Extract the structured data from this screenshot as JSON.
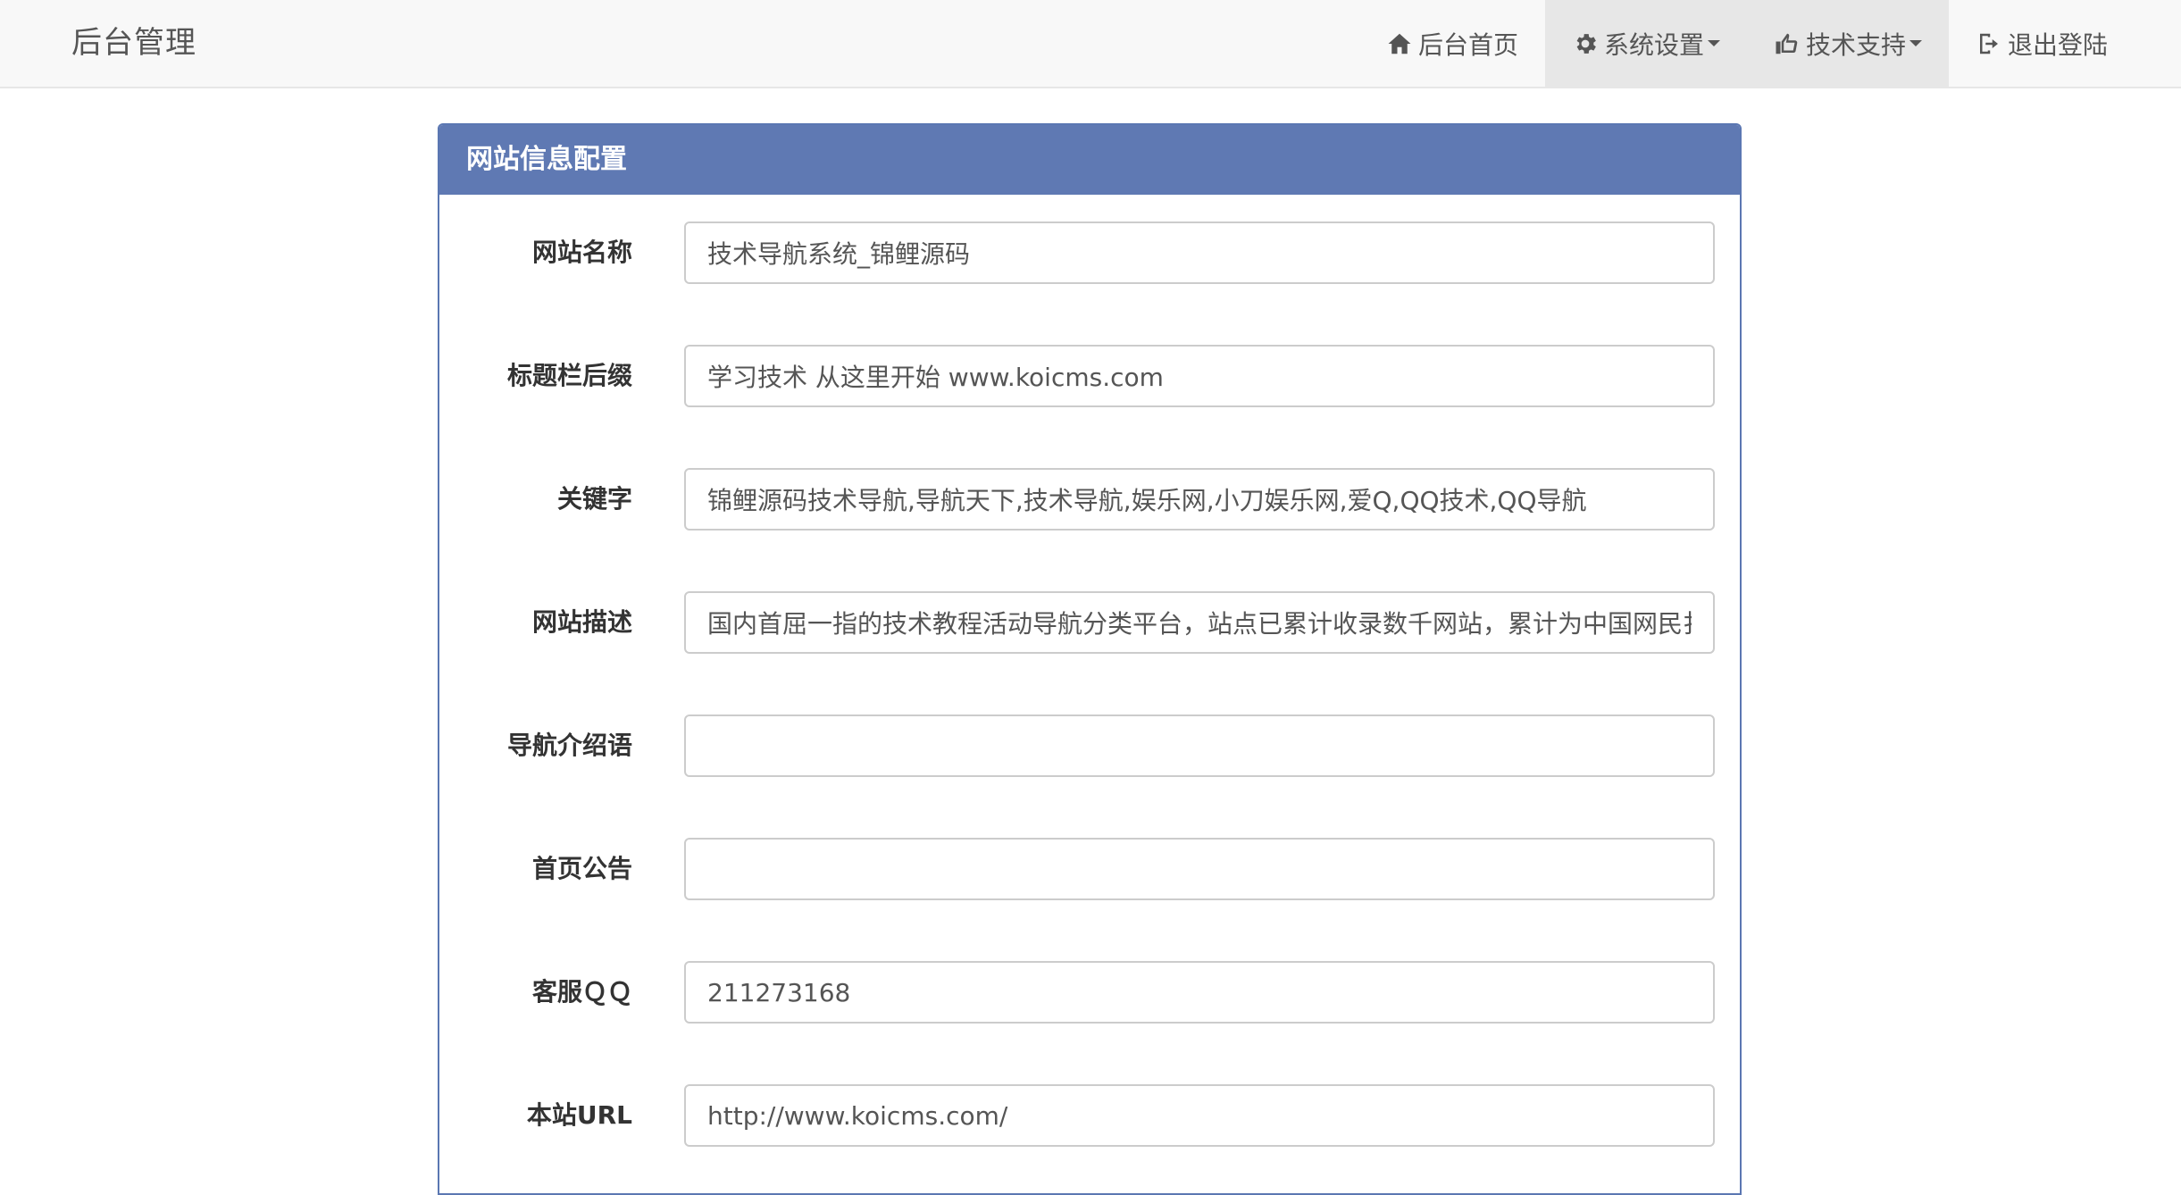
{
  "navbar": {
    "brand": "后台管理",
    "items": [
      {
        "label": "后台首页",
        "icon": "home-icon",
        "dropdown": false,
        "active": false
      },
      {
        "label": "系统设置",
        "icon": "gear-icon",
        "dropdown": true,
        "active": true
      },
      {
        "label": "技术支持",
        "icon": "thumbs-up-icon",
        "dropdown": true,
        "active": true
      },
      {
        "label": "退出登陆",
        "icon": "logout-icon",
        "dropdown": false,
        "active": false
      }
    ]
  },
  "panel": {
    "title": "网站信息配置",
    "fields": [
      {
        "label": "网站名称",
        "value": "技术导航系统_锦鲤源码"
      },
      {
        "label": "标题栏后缀",
        "value": "学习技术 从这里开始 www.koicms.com"
      },
      {
        "label": "关键字",
        "value": "锦鲤源码技术导航,导航天下,技术导航,娱乐网,小刀娱乐网,爱Q,QQ技术,QQ导航"
      },
      {
        "label": "网站描述",
        "value": "国内首屈一指的技术教程活动导航分类平台，站点已累计收录数千网站，累计为中国网民扌"
      },
      {
        "label": "导航介绍语",
        "value": ""
      },
      {
        "label": "首页公告",
        "value": ""
      },
      {
        "label": "客服ＱＱ",
        "value": "211273168"
      },
      {
        "label": "本站URL",
        "value": "http://www.koicms.com/"
      }
    ]
  },
  "colors": {
    "panel_heading": "#5f79b3",
    "navbar_bg": "#f8f8f8",
    "nav_active_bg": "#e7e7e7"
  }
}
